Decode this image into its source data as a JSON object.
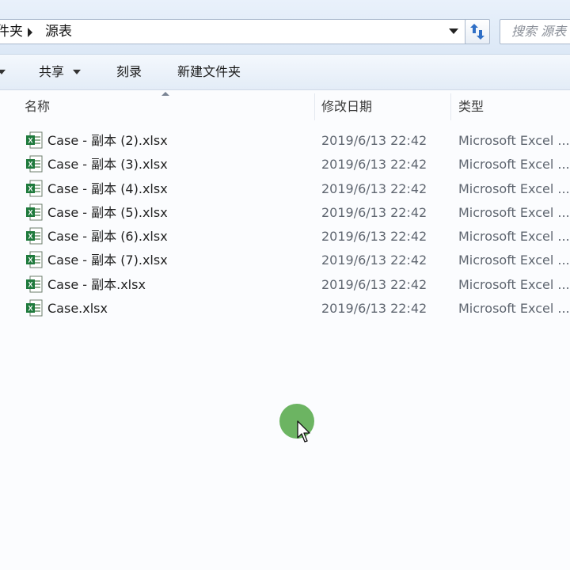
{
  "address_bar": {
    "breadcrumb": [
      "件夹",
      "源表"
    ],
    "search_placeholder": "搜索 源表"
  },
  "toolbar": {
    "share_label": "共享",
    "burn_label": "刻录",
    "new_folder_label": "新建文件夹"
  },
  "columns": {
    "name": "名称",
    "date_modified": "修改日期",
    "type": "类型"
  },
  "files": [
    {
      "name": "Case - 副本 (2).xlsx",
      "date": "2019/6/13 22:42",
      "type": "Microsoft Excel ..."
    },
    {
      "name": "Case - 副本 (3).xlsx",
      "date": "2019/6/13 22:42",
      "type": "Microsoft Excel ..."
    },
    {
      "name": "Case - 副本 (4).xlsx",
      "date": "2019/6/13 22:42",
      "type": "Microsoft Excel ..."
    },
    {
      "name": "Case - 副本 (5).xlsx",
      "date": "2019/6/13 22:42",
      "type": "Microsoft Excel ..."
    },
    {
      "name": "Case - 副本 (6).xlsx",
      "date": "2019/6/13 22:42",
      "type": "Microsoft Excel ..."
    },
    {
      "name": "Case - 副本 (7).xlsx",
      "date": "2019/6/13 22:42",
      "type": "Microsoft Excel ..."
    },
    {
      "name": "Case - 副本.xlsx",
      "date": "2019/6/13 22:42",
      "type": "Microsoft Excel ..."
    },
    {
      "name": "Case.xlsx",
      "date": "2019/6/13 22:42",
      "type": "Microsoft Excel ..."
    }
  ],
  "icons": {
    "file": "excel-file-icon",
    "refresh": "refresh-icon",
    "cursor": "mouse-cursor-icon"
  },
  "colors": {
    "excel_green": "#1e7a3c",
    "click_indicator": "#6cb462"
  }
}
